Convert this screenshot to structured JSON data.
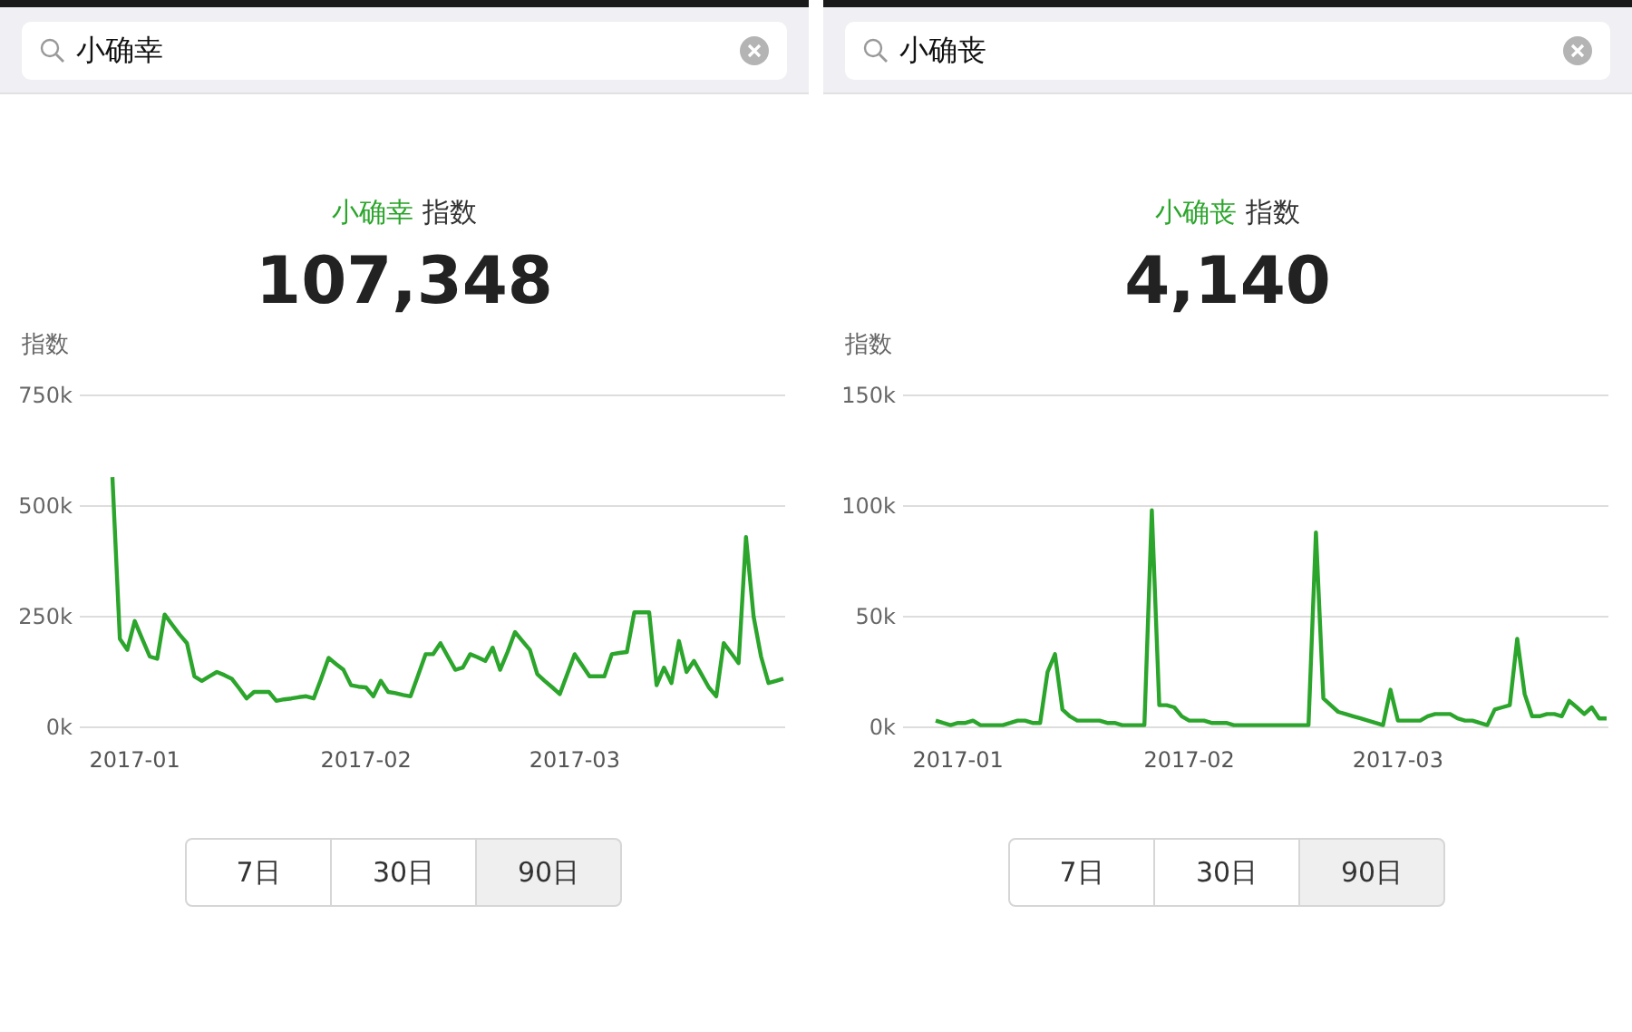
{
  "panels": [
    {
      "search": {
        "value": "小确幸"
      },
      "title": {
        "keyword": "小确幸",
        "suffix": "指数"
      },
      "total": "107,348",
      "ranges": [
        {
          "label": "7日",
          "selected": false
        },
        {
          "label": "30日",
          "selected": false
        },
        {
          "label": "90日",
          "selected": true
        }
      ],
      "chart_data": {
        "type": "line",
        "ylabel": "指数",
        "ylim": [
          0,
          750000
        ],
        "yticks": [
          {
            "value": 0,
            "label": "0k"
          },
          {
            "value": 250000,
            "label": "250k"
          },
          {
            "value": 500000,
            "label": "500k"
          },
          {
            "value": 750000,
            "label": "750k"
          }
        ],
        "categories": [
          null,
          null,
          null,
          "2017-01",
          null,
          null,
          null,
          null,
          null,
          null,
          null,
          null,
          null,
          null,
          null,
          null,
          null,
          null,
          null,
          null,
          null,
          null,
          null,
          null,
          null,
          null,
          null,
          null,
          null,
          null,
          null,
          null,
          null,
          null,
          "2017-02",
          null,
          null,
          null,
          null,
          null,
          null,
          null,
          null,
          null,
          null,
          null,
          null,
          null,
          null,
          null,
          null,
          null,
          null,
          null,
          null,
          null,
          null,
          null,
          null,
          null,
          null,
          null,
          "2017-03",
          null,
          null,
          null,
          null,
          null,
          null,
          null,
          null,
          null,
          null,
          null,
          null,
          null,
          null,
          null,
          null,
          null,
          null,
          null,
          null,
          null,
          null,
          null,
          null,
          null,
          null,
          null,
          null
        ],
        "series": [
          {
            "color": "#2ba52b",
            "values": [
              565000,
              200000,
              175000,
              240000,
              200000,
              160000,
              155000,
              255000,
              232000,
              210000,
              190000,
              115000,
              105000,
              115000,
              125000,
              118000,
              110000,
              88000,
              65000,
              80000,
              80000,
              80000,
              60000,
              63000,
              65000,
              68000,
              70000,
              65000,
              110000,
              157000,
              143000,
              130000,
              95000,
              92000,
              90000,
              70000,
              105000,
              80000,
              77000,
              73000,
              70000,
              118000,
              165000,
              165000,
              190000,
              160000,
              130000,
              135000,
              165000,
              158000,
              150000,
              180000,
              130000,
              170000,
              215000,
              195000,
              175000,
              120000,
              105000,
              90000,
              75000,
              120000,
              165000,
              140000,
              115000,
              115000,
              115000,
              165000,
              168000,
              170000,
              260000,
              260000,
              260000,
              95000,
              135000,
              100000,
              195000,
              125000,
              150000,
              120000,
              90000,
              70000,
              190000,
              168000,
              145000,
              430000,
              250000,
              160000,
              100000,
              105000,
              110000
            ]
          }
        ]
      }
    },
    {
      "search": {
        "value": "小确丧"
      },
      "title": {
        "keyword": "小确丧",
        "suffix": "指数"
      },
      "total": "4,140",
      "ranges": [
        {
          "label": "7日",
          "selected": false
        },
        {
          "label": "30日",
          "selected": false
        },
        {
          "label": "90日",
          "selected": true
        }
      ],
      "chart_data": {
        "type": "line",
        "ylabel": "指数",
        "ylim": [
          0,
          150000
        ],
        "yticks": [
          {
            "value": 0,
            "label": "0k"
          },
          {
            "value": 50000,
            "label": "50k"
          },
          {
            "value": 100000,
            "label": "100k"
          },
          {
            "value": 150000,
            "label": "150k"
          }
        ],
        "categories": [
          null,
          null,
          null,
          "2017-01",
          null,
          null,
          null,
          null,
          null,
          null,
          null,
          null,
          null,
          null,
          null,
          null,
          null,
          null,
          null,
          null,
          null,
          null,
          null,
          null,
          null,
          null,
          null,
          null,
          null,
          null,
          null,
          null,
          null,
          null,
          "2017-02",
          null,
          null,
          null,
          null,
          null,
          null,
          null,
          null,
          null,
          null,
          null,
          null,
          null,
          null,
          null,
          null,
          null,
          null,
          null,
          null,
          null,
          null,
          null,
          null,
          null,
          null,
          null,
          "2017-03",
          null,
          null,
          null,
          null,
          null,
          null,
          null,
          null,
          null,
          null,
          null,
          null,
          null,
          null,
          null,
          null,
          null,
          null,
          null,
          null,
          null,
          null,
          null,
          null,
          null,
          null,
          null,
          null
        ],
        "series": [
          {
            "color": "#2ba52b",
            "values": [
              3000,
              2000,
              1000,
              2000,
              2000,
              3000,
              1000,
              1000,
              1000,
              1000,
              2000,
              3000,
              3000,
              2000,
              2000,
              25000,
              33000,
              8000,
              5000,
              3000,
              3000,
              3000,
              3000,
              2000,
              2000,
              1000,
              1000,
              1000,
              1000,
              98000,
              10000,
              10000,
              9000,
              5000,
              3000,
              3000,
              3000,
              2000,
              2000,
              2000,
              1000,
              1000,
              1000,
              1000,
              1000,
              1000,
              1000,
              1000,
              1000,
              1000,
              1000,
              88000,
              13000,
              10000,
              7000,
              6000,
              5000,
              4000,
              3000,
              2000,
              1000,
              17000,
              3000,
              3000,
              3000,
              3000,
              5000,
              6000,
              6000,
              6000,
              4000,
              3000,
              3000,
              2000,
              1000,
              8000,
              9000,
              10000,
              40000,
              15000,
              5000,
              5000,
              6000,
              6000,
              5000,
              12000,
              9000,
              6000,
              9000,
              4000,
              4000
            ]
          }
        ]
      }
    }
  ]
}
